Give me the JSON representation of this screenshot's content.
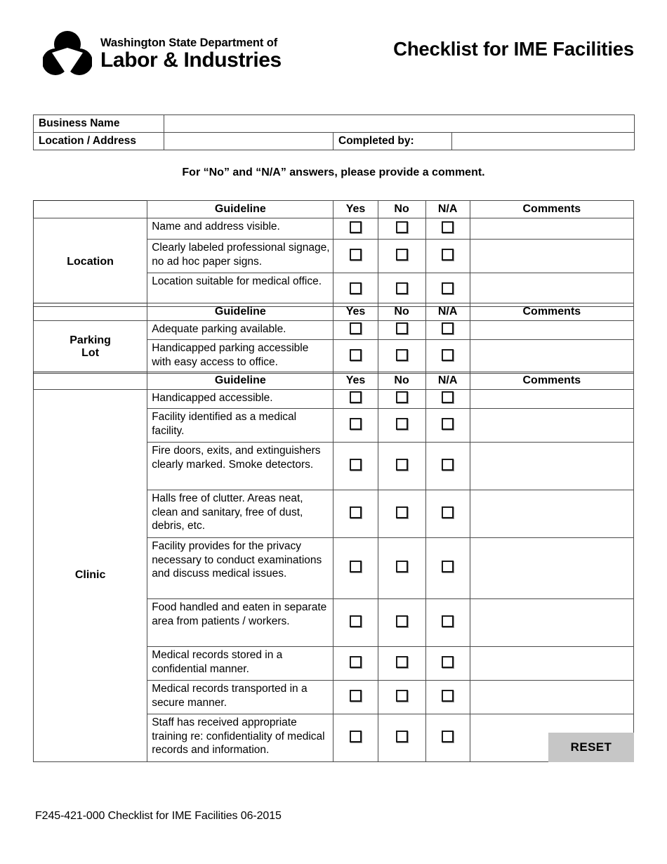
{
  "document": {
    "title": "Checklist for IME Facilities",
    "agency_line1": "Washington State Department of",
    "agency_line2": "Labor & Industries",
    "instruction": "For “No” and “N/A” answers, please provide a comment.",
    "footer": "F245-421-000 Checklist for IME Facilities 06-2015",
    "reset_label": "RESET"
  },
  "info_table": {
    "business_name_label": "Business Name",
    "business_name_value": "",
    "location_address_label": "Location / Address",
    "location_address_value": "",
    "completed_by_label": "Completed by:",
    "completed_by_value": ""
  },
  "columns": {
    "guideline": "Guideline",
    "yes": "Yes",
    "no": "No",
    "na": "N/A",
    "comments": "Comments"
  },
  "sections": [
    {
      "name": "Location",
      "rows": [
        {
          "guideline": "Name and address visible.",
          "yes": false,
          "no": false,
          "na": false,
          "comment": ""
        },
        {
          "guideline": "Clearly labeled professional signage, no ad hoc paper signs.",
          "yes": false,
          "no": false,
          "na": false,
          "comment": ""
        },
        {
          "guideline": "Location suitable for medical office.",
          "yes": false,
          "no": false,
          "na": false,
          "comment": ""
        }
      ]
    },
    {
      "name": "Parking\nLot",
      "name_line1": "Parking",
      "name_line2": "Lot",
      "rows": [
        {
          "guideline": "Adequate parking available.",
          "yes": false,
          "no": false,
          "na": false,
          "comment": ""
        },
        {
          "guideline": "Handicapped parking accessible with easy access to office.",
          "yes": false,
          "no": false,
          "na": false,
          "comment": ""
        }
      ]
    },
    {
      "name": "Clinic",
      "rows": [
        {
          "guideline": "Handicapped accessible.",
          "yes": false,
          "no": false,
          "na": false,
          "comment": ""
        },
        {
          "guideline": "Facility identified as a medical facility.",
          "yes": false,
          "no": false,
          "na": false,
          "comment": ""
        },
        {
          "guideline": "Fire doors, exits, and extinguishers clearly marked. Smoke detectors.",
          "yes": false,
          "no": false,
          "na": false,
          "comment": ""
        },
        {
          "guideline": "Halls free of clutter.  Areas neat, clean and sanitary, free of dust, debris, etc.",
          "yes": false,
          "no": false,
          "na": false,
          "comment": ""
        },
        {
          "guideline": "Facility provides for the privacy necessary to conduct examinations and discuss medical issues.",
          "yes": false,
          "no": false,
          "na": false,
          "comment": ""
        },
        {
          "guideline": "Food handled and eaten in separate area from patients / workers.",
          "yes": false,
          "no": false,
          "na": false,
          "comment": ""
        },
        {
          "guideline": "Medical records stored in a confidential manner.",
          "yes": false,
          "no": false,
          "na": false,
          "comment": ""
        },
        {
          "guideline": "Medical records transported in a secure manner.",
          "yes": false,
          "no": false,
          "na": false,
          "comment": ""
        },
        {
          "guideline": "Staff has received appropriate training re: confidentiality of medical records and information.",
          "yes": false,
          "no": false,
          "na": false,
          "comment": ""
        }
      ]
    }
  ],
  "colors": {
    "border": "#2b2b2b",
    "inner_border": "#4a4a4a",
    "reset_bg": "#c6c6c6",
    "text": "#000000"
  }
}
